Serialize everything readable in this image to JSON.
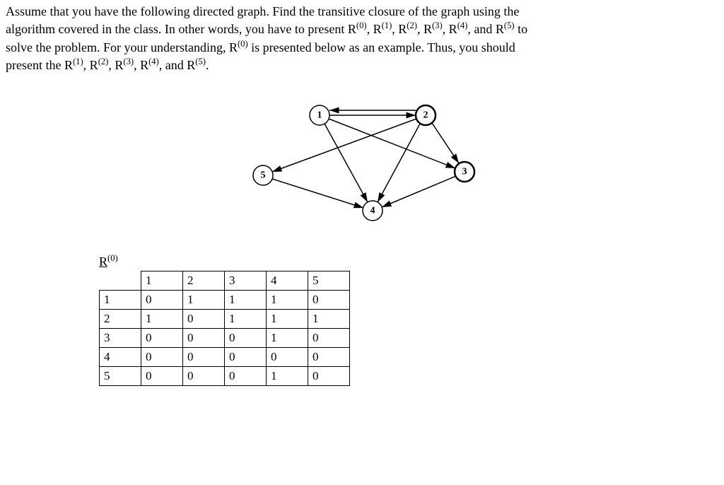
{
  "problem": {
    "line1a": "Assume that you have the following directed graph. Find the transitive closure of the graph using the",
    "line2a": "algorithm covered in the class. In other words, you have to present R",
    "sup0": "(0)",
    "line2b": ", R",
    "sup1": "(1)",
    "line2c": ", R",
    "sup2": "(2)",
    "line2d": ", R",
    "sup3": "(3)",
    "line2e": ", R",
    "sup4": "(4)",
    "line2f": ", and R",
    "sup5": "(5)",
    "line2g": " to",
    "line3a": "solve the problem. For your understanding, R",
    "line3sup": "(0)",
    "line3b": " is presented below as an example. Thus, you should",
    "line4a": "present the R",
    "l4s1": "(1)",
    "line4b": ", R",
    "l4s2": "(2)",
    "line4c": ", R",
    "l4s3": "(3)",
    "line4d": ", R",
    "l4s4": "(4)",
    "line4e": ", and R",
    "l4s5": "(5)",
    "line4f": "."
  },
  "graph": {
    "nodes": {
      "n1": "1",
      "n2": "2",
      "n3": "3",
      "n4": "4",
      "n5": "5"
    }
  },
  "matrix_label_prefix": "R",
  "matrix_label_sup": "(0)",
  "chart_data": {
    "type": "table",
    "title": "R(0)",
    "columns": [
      "1",
      "2",
      "3",
      "4",
      "5"
    ],
    "rows": [
      "1",
      "2",
      "3",
      "4",
      "5"
    ],
    "values": [
      [
        0,
        1,
        1,
        1,
        0
      ],
      [
        1,
        0,
        1,
        1,
        1
      ],
      [
        0,
        0,
        0,
        1,
        0
      ],
      [
        0,
        0,
        0,
        0,
        0
      ],
      [
        0,
        0,
        0,
        1,
        0
      ]
    ]
  }
}
